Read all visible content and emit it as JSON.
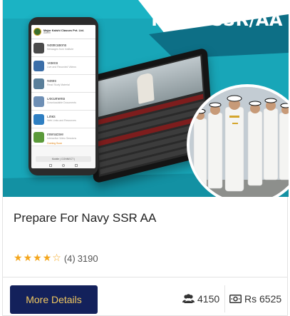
{
  "banner": {
    "title": "NAVY SSR/AA",
    "phone": {
      "org_name": "Major Kalshi Classes Pvt. Ltd.",
      "user": "Admin",
      "menu": [
        {
          "title": "Notifications",
          "sub": "Messages from Institute",
          "icon": "bell-icon",
          "color": "#4a4a4a",
          "highlight": false
        },
        {
          "title": "Videos",
          "sub": "Live and Recorded Videos",
          "icon": "video-icon",
          "color": "#3b6ea8",
          "highlight": false
        },
        {
          "title": "Notes",
          "sub": "Read Study Material",
          "icon": "notes-icon",
          "color": "#5a7f9a",
          "highlight": false
        },
        {
          "title": "Documents",
          "sub": "Downloadable Documents",
          "icon": "documents-icon",
          "color": "#6e8fb5",
          "highlight": false
        },
        {
          "title": "Links",
          "sub": "Web Links and Resources",
          "icon": "link-icon",
          "color": "#2f7fc2",
          "highlight": false
        },
        {
          "title": "Interactive",
          "sub": "Interactive Video Sessions",
          "icon": "interactive-icon",
          "color": "#5b9a3a",
          "highlight": false
        },
        {
          "title": "",
          "sub": "Coming Soon",
          "icon": "",
          "color": "#ffffff",
          "highlight": true
        }
      ],
      "footer": "Mobile | CONNECT |"
    }
  },
  "course": {
    "title": "Prepare For Navy SSR AA",
    "rating": 4,
    "rating_max": 5,
    "reviews": "(4)",
    "views": "3190"
  },
  "actions": {
    "details_label": "More Details"
  },
  "stats": {
    "students": "4150",
    "price": "Rs 6525"
  },
  "colors": {
    "banner_teal": "#18a6b8",
    "button_navy": "#13215b",
    "button_text": "#f0c860",
    "star": "#f4a61c"
  }
}
